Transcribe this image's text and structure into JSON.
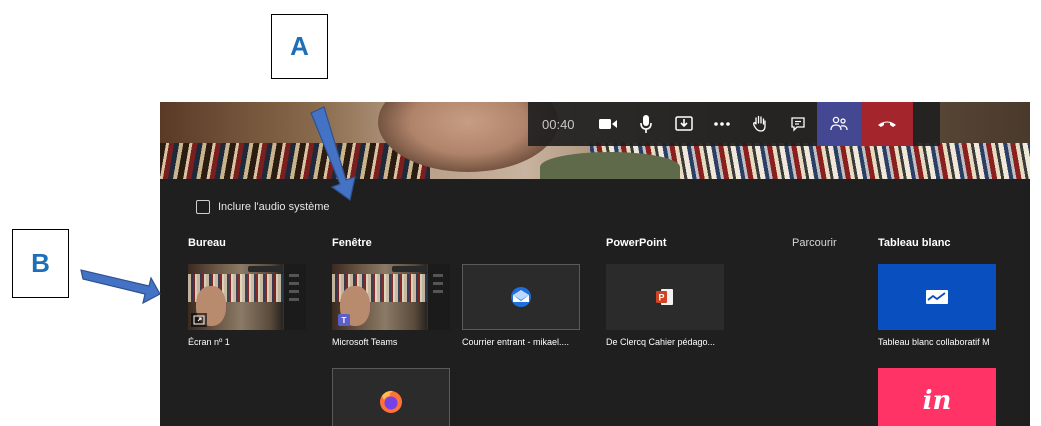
{
  "callouts": {
    "a": "A",
    "b": "B"
  },
  "colors": {
    "callout_text": "#1f6fb8",
    "arrow_fill": "#4472c4",
    "arrow_stroke": "#2f528f",
    "panel_bg": "#1f1f1f",
    "toolbar_active": "#444791",
    "hangup": "#a4262c",
    "whiteboard_tile": "#0a4fbf",
    "invision_tile": "#ff3366"
  },
  "toolbar": {
    "timer": "00:40",
    "icons": [
      "camera-icon",
      "microphone-icon",
      "share-tray-icon",
      "more-options-icon",
      "raise-hand-icon",
      "chat-icon",
      "participants-icon",
      "hang-up-icon"
    ]
  },
  "share_panel": {
    "include_audio_label": "Inclure l'audio système",
    "include_audio_checked": false,
    "sections": {
      "desktop": "Bureau",
      "window": "Fenêtre",
      "powerpoint": "PowerPoint",
      "browse": "Parcourir",
      "whiteboard": "Tableau blanc"
    },
    "tiles": {
      "screen1": "Écran nº 1",
      "teams": "Microsoft Teams",
      "outlook": "Courrier entrant - mikael....",
      "pptx": "De Clercq Cahier pédago...",
      "whiteboard": "Tableau blanc collaboratif M",
      "invision_logo": "in"
    }
  }
}
